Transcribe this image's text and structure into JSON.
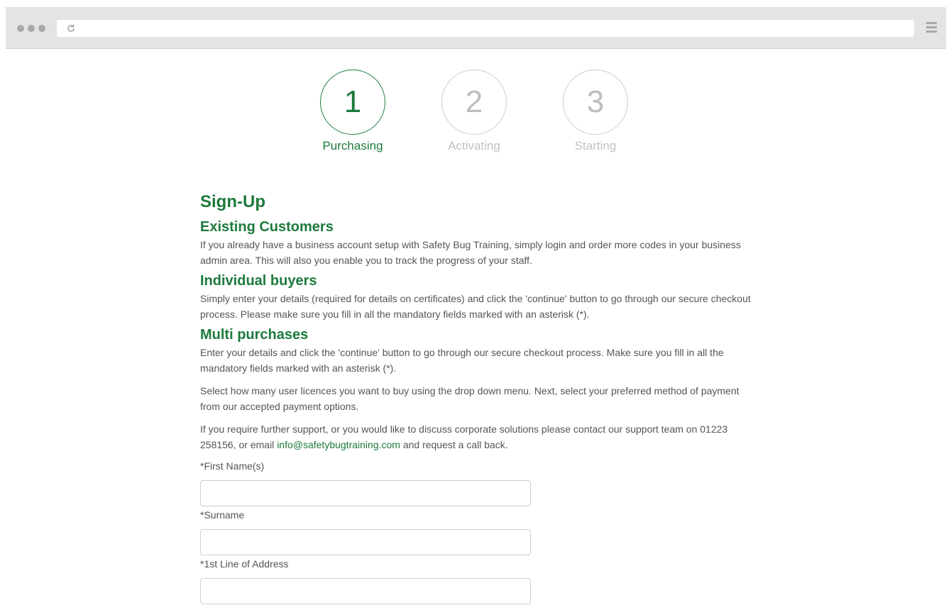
{
  "steps": [
    {
      "number": "1",
      "label": "Purchasing",
      "active": true
    },
    {
      "number": "2",
      "label": "Activating",
      "active": false
    },
    {
      "number": "3",
      "label": "Starting",
      "active": false
    }
  ],
  "colors": {
    "accent": "#1d7a3c",
    "text": "#555555",
    "inactive": "#c2c2c2"
  },
  "page_title": "Sign-Up",
  "sections": {
    "existing": {
      "heading": "Existing Customers",
      "body": "If you already have a business account setup with Safety Bug Training, simply login and order more codes in your business admin area. This will also you enable you to track the progress of your staff."
    },
    "individual": {
      "heading": "Individual buyers",
      "body": "Simply enter your details (required for details on certificates) and click the 'continue' button to go through our secure checkout process. Please make sure you fill in all the mandatory fields marked with an asterisk (*)."
    },
    "multi": {
      "heading": "Multi purchases",
      "body": "Enter your details and click the 'continue' button to go through our secure checkout process. Make sure you fill in all the mandatory fields marked with an asterisk (*).",
      "body2": "Select how many user licences you want to buy using the drop down menu. Next, select your preferred method of payment from our accepted payment options.",
      "support_before": "If you require further support, or you would like to discuss corporate solutions please contact our support team on 01223 258156, or email ",
      "support_email": "info@safetybugtraining.com",
      "support_after": " and request a call back."
    }
  },
  "form": {
    "first_name_label": "*First Name(s)",
    "first_name_value": "",
    "surname_label": "*Surname",
    "surname_value": "",
    "address1_label": "*1st Line of Address",
    "address1_value": ""
  }
}
